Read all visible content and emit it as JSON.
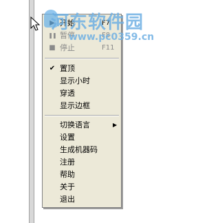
{
  "watermark": {
    "title": "河东软件园",
    "url": "www.pc0359.cn"
  },
  "menu": {
    "items": [
      {
        "label": "开始",
        "accel": "F7",
        "icon": "play-icon",
        "icon_glyph": "▶",
        "disabled": false
      },
      {
        "label": "暂停",
        "accel": "F8",
        "icon": "pause-icon",
        "icon_glyph": "❚❚",
        "disabled": true
      },
      {
        "label": "停止",
        "accel": "F11",
        "icon": "stop-icon",
        "icon_glyph": "■",
        "disabled": true
      },
      {
        "label": "置顶",
        "checked": true,
        "check_glyph": "✔"
      },
      {
        "label": "显示小时"
      },
      {
        "label": "穿透"
      },
      {
        "label": "显示边框"
      },
      {
        "label": "切换语言",
        "submenu": true,
        "arrow_glyph": "▶"
      },
      {
        "label": "设置"
      },
      {
        "label": "生成机器码"
      },
      {
        "label": "注册"
      },
      {
        "label": "帮助"
      },
      {
        "label": "关于"
      },
      {
        "label": "退出"
      }
    ]
  }
}
